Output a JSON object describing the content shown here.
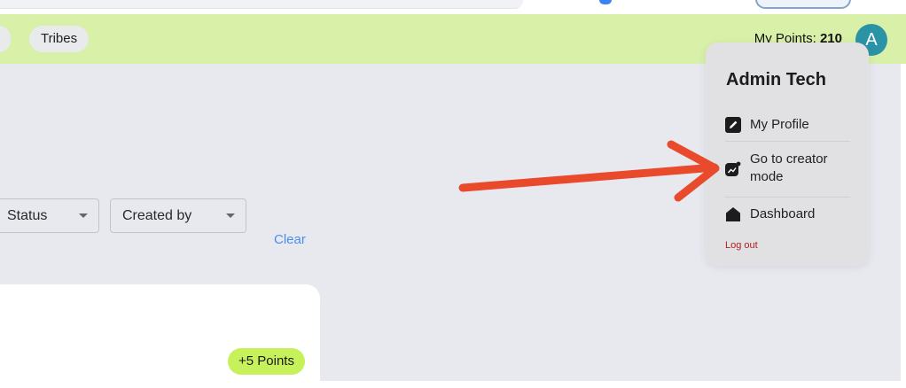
{
  "header": {
    "tabs": [
      {
        "label": ""
      },
      {
        "label": "Tribes"
      }
    ],
    "points_label": "My Points:",
    "points_value": "210",
    "avatar_initial": "A"
  },
  "filters": {
    "status_label": "Status",
    "created_by_label": "Created by",
    "clear_label": "Clear"
  },
  "card": {
    "points_badge": "+5 Points"
  },
  "user_menu": {
    "name": "Admin Tech",
    "items": [
      {
        "label": "My Profile",
        "icon": "edit-icon"
      },
      {
        "label": "Go to creator mode",
        "icon": "creator-icon"
      },
      {
        "label": "Dashboard",
        "icon": "home-icon"
      }
    ],
    "logout_label": "Log out"
  },
  "colors": {
    "header_bg": "#d8f0a8",
    "avatar_bg": "#2b93a6",
    "badge_bg": "#c6f15a",
    "link": "#4a8ff0",
    "logout": "#b02020",
    "annotation_arrow": "#ea4a2c"
  }
}
